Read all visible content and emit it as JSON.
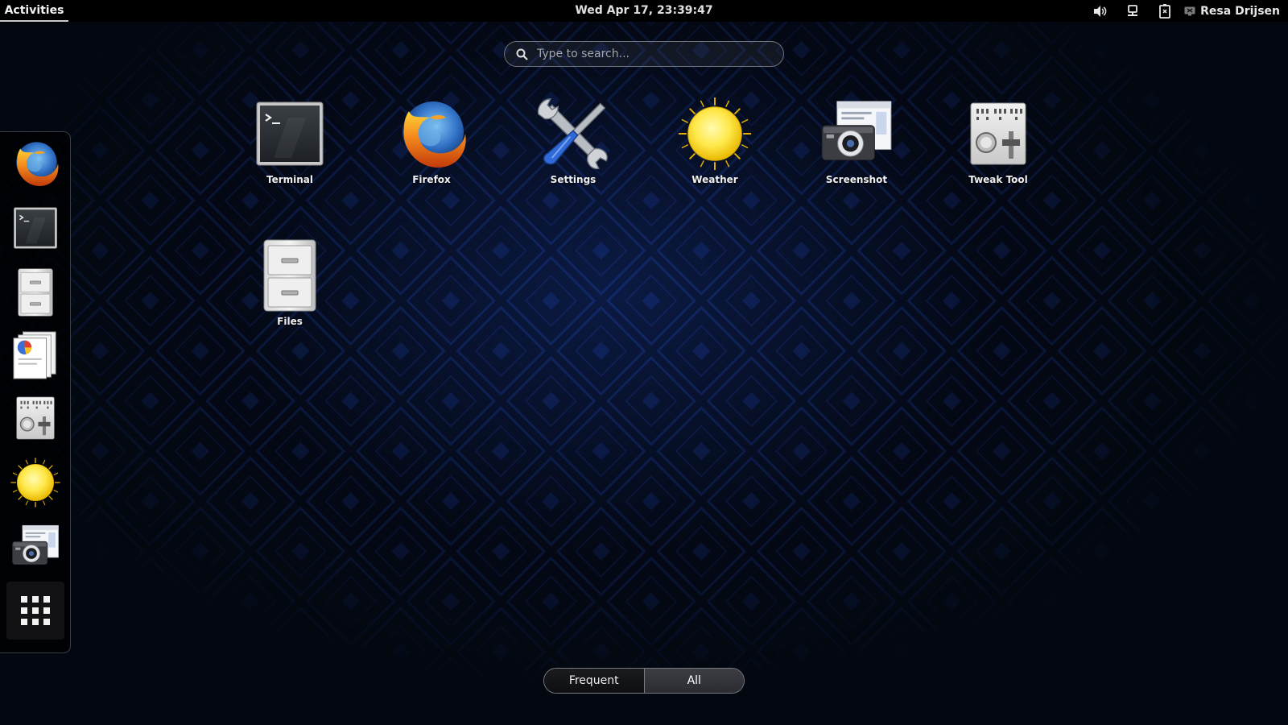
{
  "topbar": {
    "activities_label": "Activities",
    "clock": "Wed Apr 17, 23:39:47",
    "tray": [
      {
        "icon": "volume-icon"
      },
      {
        "icon": "network-icon"
      },
      {
        "icon": "battery-icon"
      }
    ],
    "user_name": "Resa Drijsen"
  },
  "search": {
    "placeholder": "Type to search...",
    "value": ""
  },
  "dash": {
    "items": [
      {
        "icon": "firefox-icon"
      },
      {
        "icon": "terminal-icon"
      },
      {
        "icon": "files-icon"
      },
      {
        "icon": "documents-icon"
      },
      {
        "icon": "tweak-tool-icon"
      },
      {
        "icon": "weather-icon"
      },
      {
        "icon": "screenshot-icon"
      },
      {
        "icon": "show-applications-icon"
      }
    ]
  },
  "apps": [
    {
      "label": "Terminal",
      "icon": "terminal-icon"
    },
    {
      "label": "Firefox",
      "icon": "firefox-icon"
    },
    {
      "label": "Settings",
      "icon": "settings-icon"
    },
    {
      "label": "Weather",
      "icon": "weather-icon"
    },
    {
      "label": "Screenshot",
      "icon": "screenshot-icon"
    },
    {
      "label": "Tweak Tool",
      "icon": "tweak-tool-icon"
    },
    {
      "label": "Files",
      "icon": "files-icon"
    }
  ],
  "view_switch": {
    "frequent_label": "Frequent",
    "all_label": "All",
    "selected": "All"
  },
  "colors": {
    "topbar_bg": "#000000",
    "wallpaper_base": "#03070f",
    "wallpaper_pattern": "#1a3a9a"
  }
}
